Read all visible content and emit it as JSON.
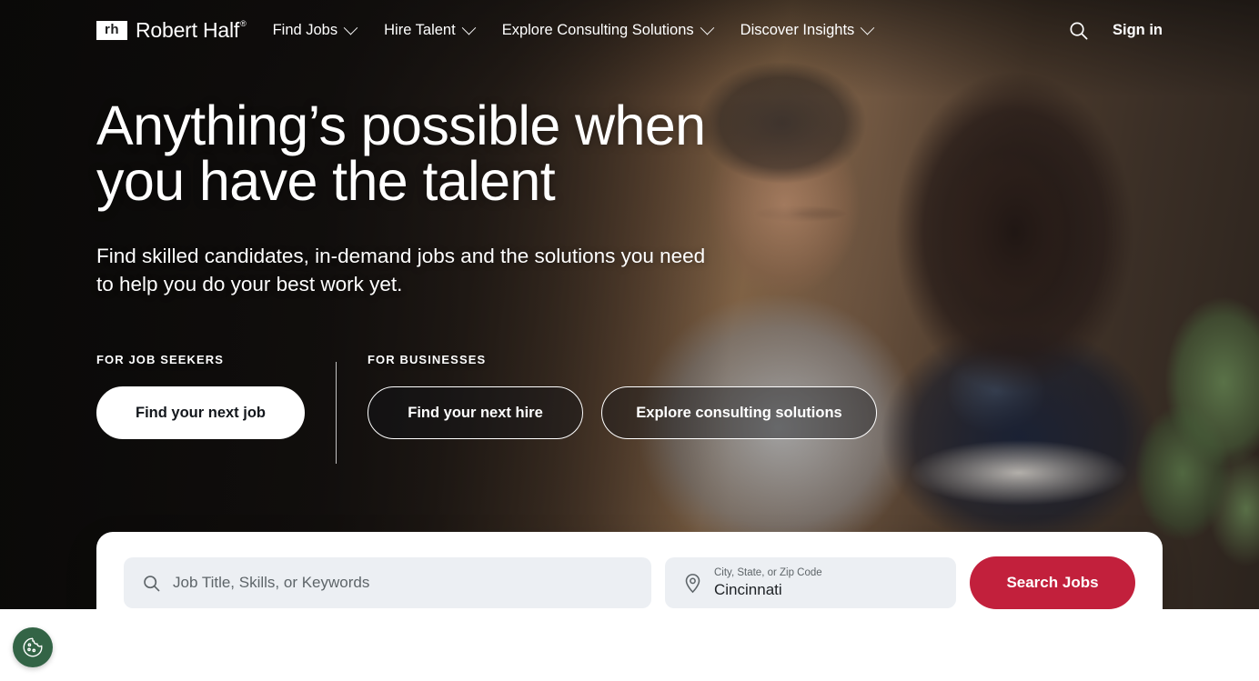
{
  "brand": {
    "logo_mark": "rh",
    "logo_name": "Robert Half",
    "logo_registered": "®",
    "accent_red": "#C2203C",
    "cookie_green": "#336446"
  },
  "header": {
    "nav": [
      {
        "label": "Find Jobs",
        "has_dropdown": true
      },
      {
        "label": "Hire Talent",
        "has_dropdown": true
      },
      {
        "label": "Explore Consulting Solutions",
        "has_dropdown": true
      },
      {
        "label": "Discover Insights",
        "has_dropdown": true
      }
    ],
    "search_icon": "search-icon",
    "sign_in": "Sign in"
  },
  "hero": {
    "title": "Anything’s possible when you have the talent",
    "subtitle": "Find skilled candidates, in-demand jobs and the solutions you need to help you do your best work yet.",
    "job_seekers": {
      "label": "FOR JOB SEEKERS",
      "buttons": [
        {
          "label": "Find your next job",
          "style": "white"
        }
      ]
    },
    "businesses": {
      "label": "FOR BUSINESSES",
      "buttons": [
        {
          "label": "Find your next hire",
          "style": "outline"
        },
        {
          "label": "Explore consulting solutions",
          "style": "outline"
        }
      ]
    }
  },
  "search_card": {
    "keywords": {
      "icon": "search-icon",
      "placeholder": "Job Title, Skills, or Keywords",
      "value": ""
    },
    "location": {
      "icon": "map-pin-icon",
      "label": "City, State, or Zip Code",
      "value": "Cincinnati"
    },
    "submit_label": "Search Jobs"
  },
  "cookie_widget": {
    "icon": "cookie-icon",
    "label": "Cookie preferences"
  }
}
